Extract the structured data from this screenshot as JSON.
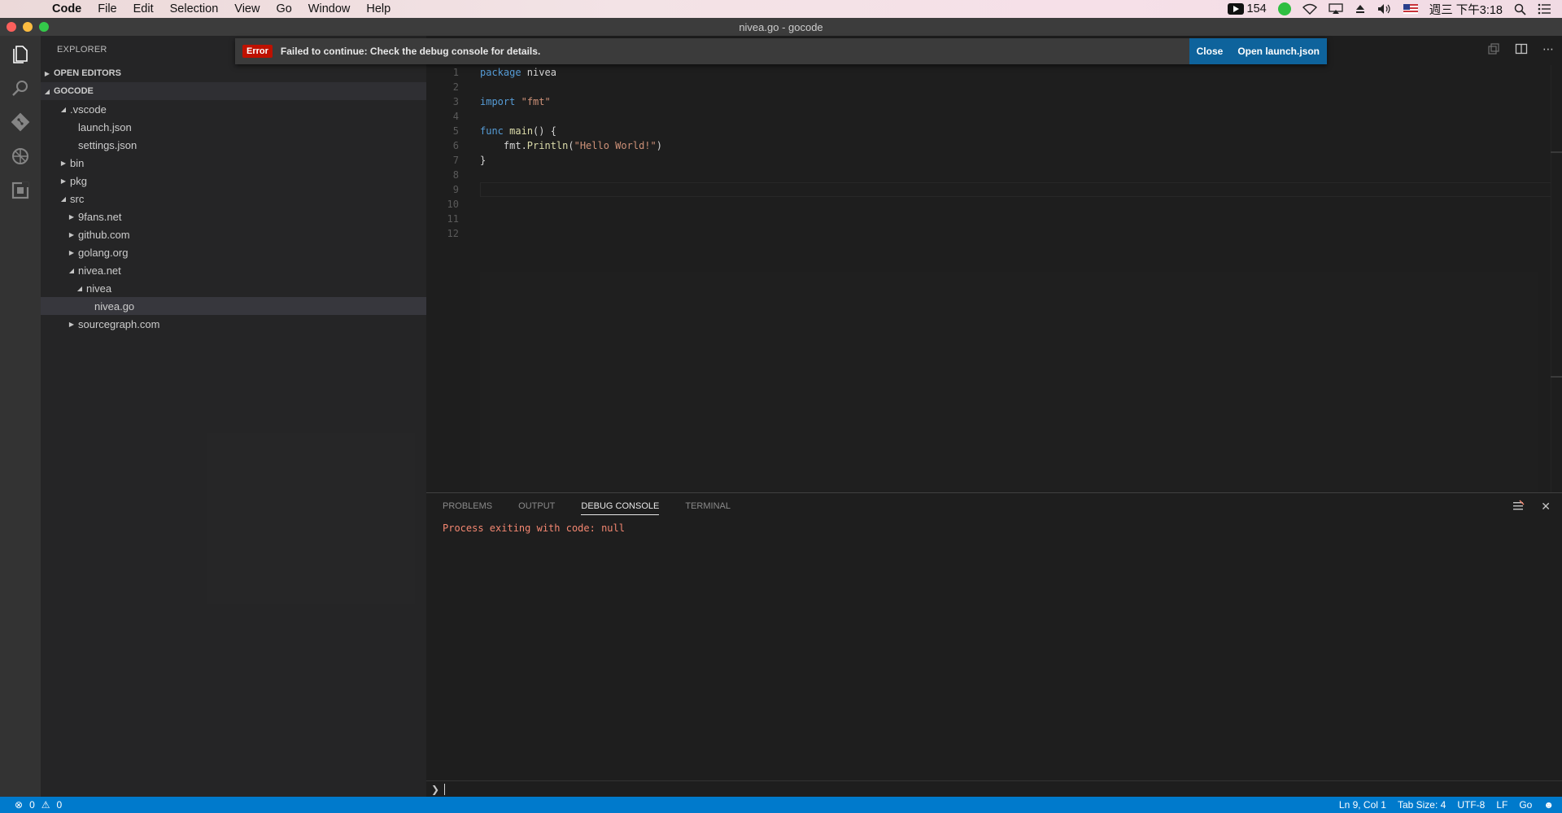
{
  "menubar": {
    "app_name": "Code",
    "items": [
      "File",
      "Edit",
      "Selection",
      "View",
      "Go",
      "Window",
      "Help"
    ],
    "youtube_count": "154",
    "clock": "週三 下午3:18"
  },
  "window": {
    "title": "nivea.go - gocode"
  },
  "sidebar": {
    "title": "EXPLORER",
    "open_editors_label": "OPEN EDITORS",
    "workspace_label": "GOCODE",
    "tree": [
      {
        "label": ".vscode",
        "depth": 1,
        "state": "expanded"
      },
      {
        "label": "launch.json",
        "depth": 2,
        "state": "file"
      },
      {
        "label": "settings.json",
        "depth": 2,
        "state": "file"
      },
      {
        "label": "bin",
        "depth": 1,
        "state": "collapsed"
      },
      {
        "label": "pkg",
        "depth": 1,
        "state": "collapsed"
      },
      {
        "label": "src",
        "depth": 1,
        "state": "expanded"
      },
      {
        "label": "9fans.net",
        "depth": 2,
        "state": "collapsed"
      },
      {
        "label": "github.com",
        "depth": 2,
        "state": "collapsed"
      },
      {
        "label": "golang.org",
        "depth": 2,
        "state": "collapsed"
      },
      {
        "label": "nivea.net",
        "depth": 2,
        "state": "expanded"
      },
      {
        "label": "nivea",
        "depth": 3,
        "state": "expanded"
      },
      {
        "label": "nivea.go",
        "depth": 4,
        "state": "file",
        "selected": true
      },
      {
        "label": "sourcegraph.com",
        "depth": 2,
        "state": "collapsed"
      }
    ]
  },
  "notification": {
    "severity": "Error",
    "message": "Failed to continue: Check the debug console for details.",
    "close_label": "Close",
    "open_label": "Open launch.json"
  },
  "editor": {
    "line_numbers": [
      "1",
      "2",
      "3",
      "4",
      "5",
      "6",
      "7",
      "8",
      "9",
      "10",
      "11",
      "12"
    ],
    "lines": [
      [
        {
          "t": "kw",
          "v": "package"
        },
        {
          "t": "p",
          "v": " nivea"
        }
      ],
      [],
      [
        {
          "t": "kw",
          "v": "import"
        },
        {
          "t": "p",
          "v": " "
        },
        {
          "t": "str",
          "v": "\"fmt\""
        }
      ],
      [],
      [
        {
          "t": "kw",
          "v": "func"
        },
        {
          "t": "p",
          "v": " "
        },
        {
          "t": "fn",
          "v": "main"
        },
        {
          "t": "p",
          "v": "() {"
        }
      ],
      [
        {
          "t": "p",
          "v": "    fmt."
        },
        {
          "t": "fn",
          "v": "Println"
        },
        {
          "t": "p",
          "v": "("
        },
        {
          "t": "str",
          "v": "\"Hello World!\""
        },
        {
          "t": "p",
          "v": ")"
        }
      ],
      [
        {
          "t": "p",
          "v": "}"
        }
      ],
      [],
      [],
      [],
      [],
      []
    ]
  },
  "panel": {
    "tabs": [
      "PROBLEMS",
      "OUTPUT",
      "DEBUG CONSOLE",
      "TERMINAL"
    ],
    "active_tab": "DEBUG CONSOLE",
    "console_output": "Process exiting with code: null"
  },
  "statusbar": {
    "errors": "0",
    "warnings": "0",
    "position": "Ln 9, Col 1",
    "tab_size": "Tab Size: 4",
    "encoding": "UTF-8",
    "eol": "LF",
    "language": "Go"
  },
  "colors": {
    "accent": "#007acc",
    "error": "#be1100",
    "button": "#0e639c"
  }
}
